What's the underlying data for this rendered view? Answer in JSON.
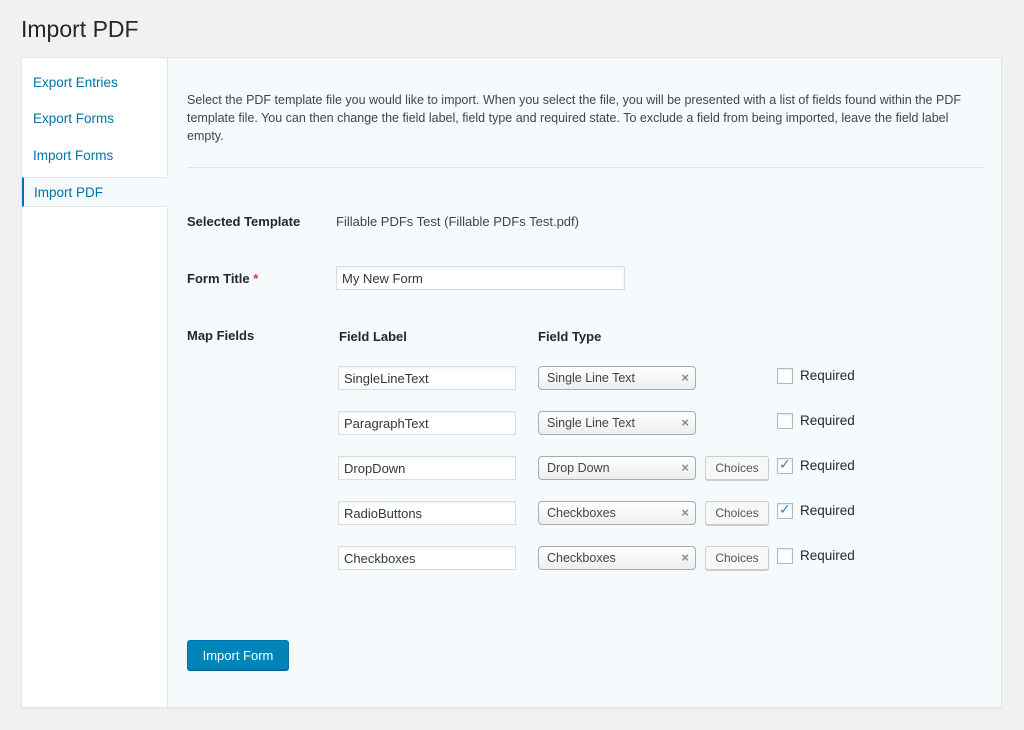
{
  "page": {
    "title": "Import PDF"
  },
  "sidebar": {
    "items": [
      {
        "label": "Export Entries"
      },
      {
        "label": "Export Forms"
      },
      {
        "label": "Import Forms"
      },
      {
        "label": "Import PDF",
        "active": true
      }
    ]
  },
  "intro": "Select the PDF template file you would like to import. When you select the file, you will be presented with a list of fields found within the PDF template file. You can then change the field label, field type and required state. To exclude a field from being imported, leave the field label empty.",
  "template": {
    "label": "Selected Template",
    "value": "Fillable PDFs Test (Fillable PDFs Test.pdf)"
  },
  "form_title": {
    "label": "Form Title",
    "required_marker": "*",
    "value": "My New Form"
  },
  "map_fields": {
    "label": "Map Fields",
    "col_label": "Field Label",
    "col_type": "Field Type",
    "clear_symbol": "×",
    "choices_label": "Choices",
    "required_label": "Required",
    "checkmark": "✓",
    "rows": [
      {
        "field_label": "SingleLineText",
        "field_type": "Single Line Text",
        "has_choices": false,
        "required": false
      },
      {
        "field_label": "ParagraphText",
        "field_type": "Single Line Text",
        "has_choices": false,
        "required": false
      },
      {
        "field_label": "DropDown",
        "field_type": "Drop Down",
        "has_choices": true,
        "required": true
      },
      {
        "field_label": "RadioButtons",
        "field_type": "Checkboxes",
        "has_choices": true,
        "required": true
      },
      {
        "field_label": "Checkboxes",
        "field_type": "Checkboxes",
        "has_choices": true,
        "required": false
      }
    ]
  },
  "actions": {
    "import_label": "Import Form"
  },
  "colors": {
    "accent": "#0073aa",
    "primary_button": "#0085ba",
    "content_bg": "#f5fafd",
    "required_star": "#dc3232"
  }
}
